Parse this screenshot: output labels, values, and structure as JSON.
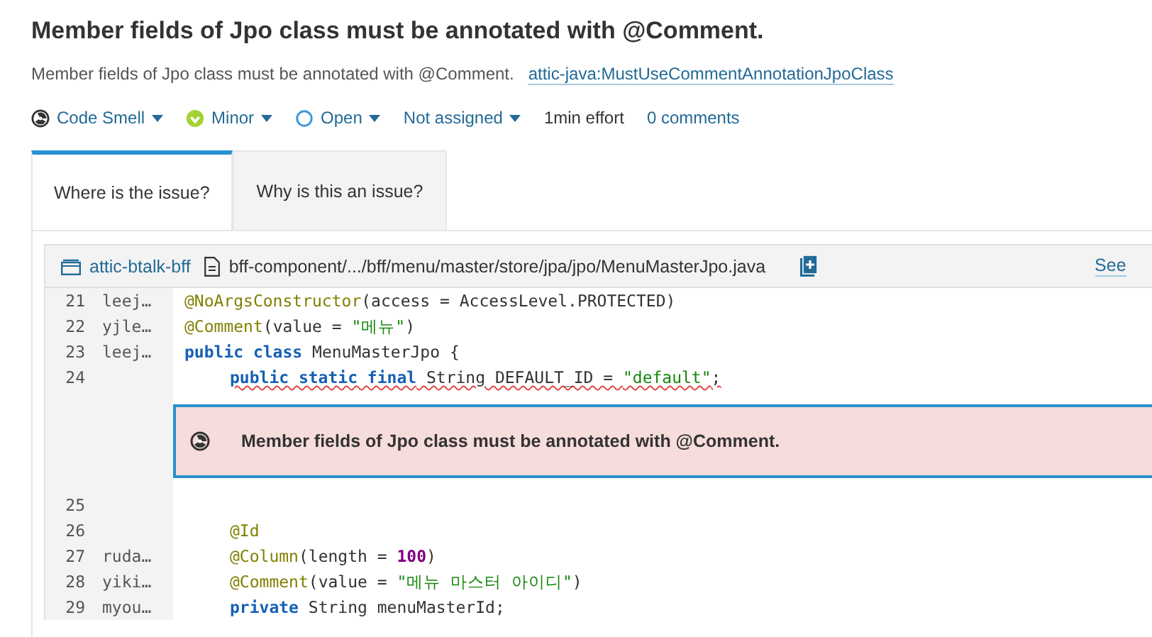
{
  "title": "Member fields of Jpo class must be annotated with @Comment.",
  "description": {
    "text": "Member fields of Jpo class must be annotated with @Comment.",
    "rule_link": "attic-java:MustUseCommentAnnotationJpoClass"
  },
  "meta": [
    {
      "kind": "type",
      "label": "Code Smell"
    },
    {
      "kind": "severity",
      "label": "Minor"
    },
    {
      "kind": "status",
      "label": "Open"
    },
    {
      "kind": "assignee",
      "label": "Not assigned"
    },
    {
      "kind": "effort",
      "label": "1min effort"
    },
    {
      "kind": "comments",
      "label": "0 comments"
    }
  ],
  "tabs": [
    {
      "label": "Where is the issue?",
      "selected": true
    },
    {
      "label": "Why is this an issue?",
      "selected": false
    }
  ],
  "file_header": {
    "project": "attic-btalk-bff",
    "path": "bff-component/.../bff/menu/master/store/jpa/jpo/MenuMasterJpo.java",
    "see_link": "See"
  },
  "code_lines": [
    {
      "number": "21",
      "author": "leej…",
      "issue": false,
      "indented": false,
      "tokens": [
        {
          "kind": "annotation",
          "text": "@NoArgsConstructor"
        },
        {
          "kind": "plain",
          "text": "(access = AccessLevel.PROTECTED)"
        }
      ]
    },
    {
      "number": "22",
      "author": "yjle…",
      "issue": false,
      "indented": false,
      "tokens": [
        {
          "kind": "annotation",
          "text": "@Comment"
        },
        {
          "kind": "plain",
          "text": "(value = "
        },
        {
          "kind": "string",
          "text": "\"메뉴\""
        },
        {
          "kind": "plain",
          "text": ")"
        }
      ]
    },
    {
      "number": "23",
      "author": "leej…",
      "issue": false,
      "indented": false,
      "tokens": [
        {
          "kind": "keyword",
          "text": "public class"
        },
        {
          "kind": "plain",
          "text": " MenuMasterJpo {"
        }
      ]
    },
    {
      "number": "24",
      "issue": true,
      "indented": true,
      "tokens": [
        {
          "kind": "keyword",
          "text": "public static final"
        },
        {
          "kind": "plain",
          "text": " String DEFAULT_ID = "
        },
        {
          "kind": "string",
          "text": "\"default\""
        },
        {
          "kind": "plain",
          "text": ";"
        }
      ]
    },
    {
      "number": "25",
      "issue": false
    },
    {
      "number": "26",
      "issue": false,
      "indented": true,
      "tokens": [
        {
          "kind": "annotation",
          "text": "@Id"
        }
      ]
    },
    {
      "number": "27",
      "author": "ruda…",
      "issue": false,
      "indented": true,
      "tokens": [
        {
          "kind": "annotation",
          "text": "@Column"
        },
        {
          "kind": "plain",
          "text": "(length = "
        },
        {
          "kind": "number",
          "text": "100"
        },
        {
          "kind": "plain",
          "text": ")"
        }
      ]
    },
    {
      "number": "28",
      "author": "yiki…",
      "issue": false,
      "indented": true,
      "tokens": [
        {
          "kind": "annotation",
          "text": "@Comment"
        },
        {
          "kind": "plain",
          "text": "(value = "
        },
        {
          "kind": "string",
          "text": "\"메뉴 마스터 아이디\""
        },
        {
          "kind": "plain",
          "text": ")"
        }
      ]
    },
    {
      "number": "29",
      "author": "myou…",
      "issue": false,
      "indented": true,
      "tokens": [
        {
          "kind": "keyword",
          "text": "private"
        },
        {
          "kind": "plain",
          "text": " String menuMasterId;"
        }
      ]
    }
  ],
  "issue_box": {
    "message": "Member fields of Jpo class must be annotated with @Comment."
  }
}
